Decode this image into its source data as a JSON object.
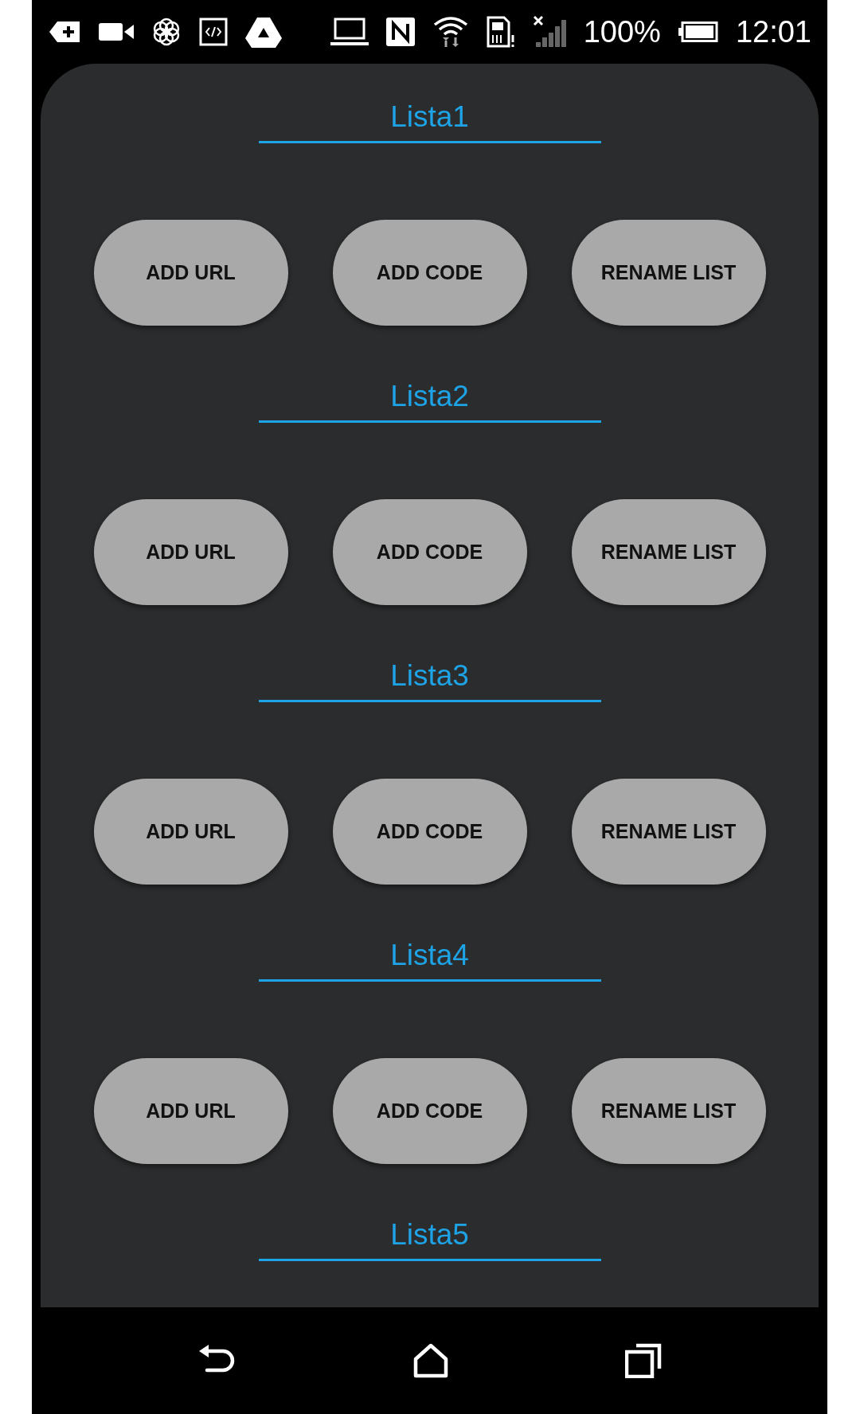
{
  "status_bar": {
    "battery": "100%",
    "time": "12:01"
  },
  "lists": [
    {
      "title": "Lista1",
      "buttons": [
        "ADD URL",
        "ADD CODE",
        "RENAME LIST"
      ]
    },
    {
      "title": "Lista2",
      "buttons": [
        "ADD URL",
        "ADD CODE",
        "RENAME LIST"
      ]
    },
    {
      "title": "Lista3",
      "buttons": [
        "ADD URL",
        "ADD CODE",
        "RENAME LIST"
      ]
    },
    {
      "title": "Lista4",
      "buttons": [
        "ADD URL",
        "ADD CODE",
        "RENAME LIST"
      ]
    },
    {
      "title": "Lista5"
    }
  ]
}
